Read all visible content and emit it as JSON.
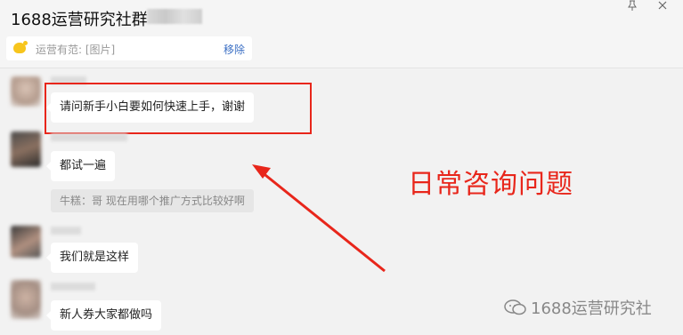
{
  "header": {
    "title": "1688运营研究社群",
    "pin_icon": "pin-icon",
    "close_icon": "close-icon"
  },
  "notice": {
    "text": "运营有范: [图片]",
    "remove_label": "移除"
  },
  "messages": [
    {
      "text": "请问新手小白要如何快速上手，谢谢"
    },
    {
      "text": "都试一遍"
    },
    {
      "quote": "牛糕：哥  现在用哪个推广方式比较好啊"
    },
    {
      "text": "我们就是这样"
    },
    {
      "text": "新人券大家都做吗"
    }
  ],
  "annotation": {
    "label": "日常咨询问题",
    "color": "#e8261b"
  },
  "watermark": {
    "text": "1688运营研究社"
  }
}
